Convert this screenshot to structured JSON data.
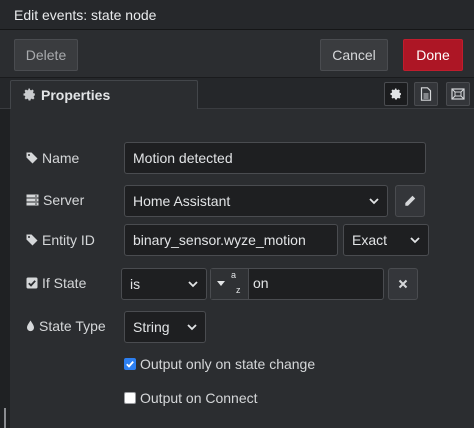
{
  "title": "Edit events: state node",
  "toolbar": {
    "delete_label": "Delete",
    "cancel_label": "Cancel",
    "done_label": "Done"
  },
  "tabs": [
    {
      "label": "Properties",
      "icon": "gear-icon"
    }
  ],
  "tab_buttons": [
    "gear-icon",
    "document-icon",
    "layout-icon"
  ],
  "form": {
    "name": {
      "label": "Name",
      "value": "Motion detected"
    },
    "server": {
      "label": "Server",
      "value": "Home Assistant"
    },
    "entity_id": {
      "label": "Entity ID",
      "value": "binary_sensor.wyze_motion",
      "match": "Exact"
    },
    "if_state": {
      "label": "If State",
      "operator": "is",
      "type_sup": "a",
      "type_sub": "z",
      "value": "on"
    },
    "state_type": {
      "label": "State Type",
      "value": "String"
    },
    "output_only_on_change": {
      "label": "Output only on state change",
      "checked": true
    },
    "output_on_connect": {
      "label": "Output on Connect",
      "checked": false
    }
  },
  "colors": {
    "done": "#ad1625",
    "checkbox": "#2d7ff0"
  }
}
